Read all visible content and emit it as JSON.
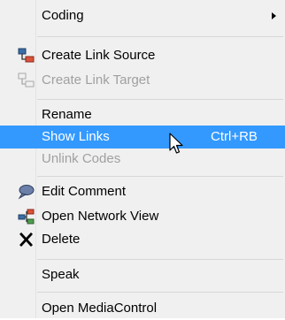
{
  "menu": {
    "items": [
      {
        "label": "Coding",
        "submenu": true
      },
      {
        "label": "Create Link Source",
        "icon": "link-source-icon"
      },
      {
        "label": "Create Link Target",
        "icon": "link-target-icon",
        "disabled": true
      },
      {
        "label": "Rename"
      },
      {
        "label": "Show Links",
        "shortcut": "Ctrl+RB",
        "highlighted": true
      },
      {
        "label": "Unlink Codes",
        "disabled": true
      },
      {
        "label": "Edit Comment",
        "icon": "speech-bubble-icon"
      },
      {
        "label": "Open Network View",
        "icon": "network-view-icon"
      },
      {
        "label": "Delete",
        "icon": "delete-x-icon"
      },
      {
        "label": "Speak"
      },
      {
        "label": "Open MediaControl"
      }
    ]
  },
  "colors": {
    "background": "#f0f0f0",
    "highlight": "#3399ff",
    "disabled_text": "#a0a0a0"
  }
}
